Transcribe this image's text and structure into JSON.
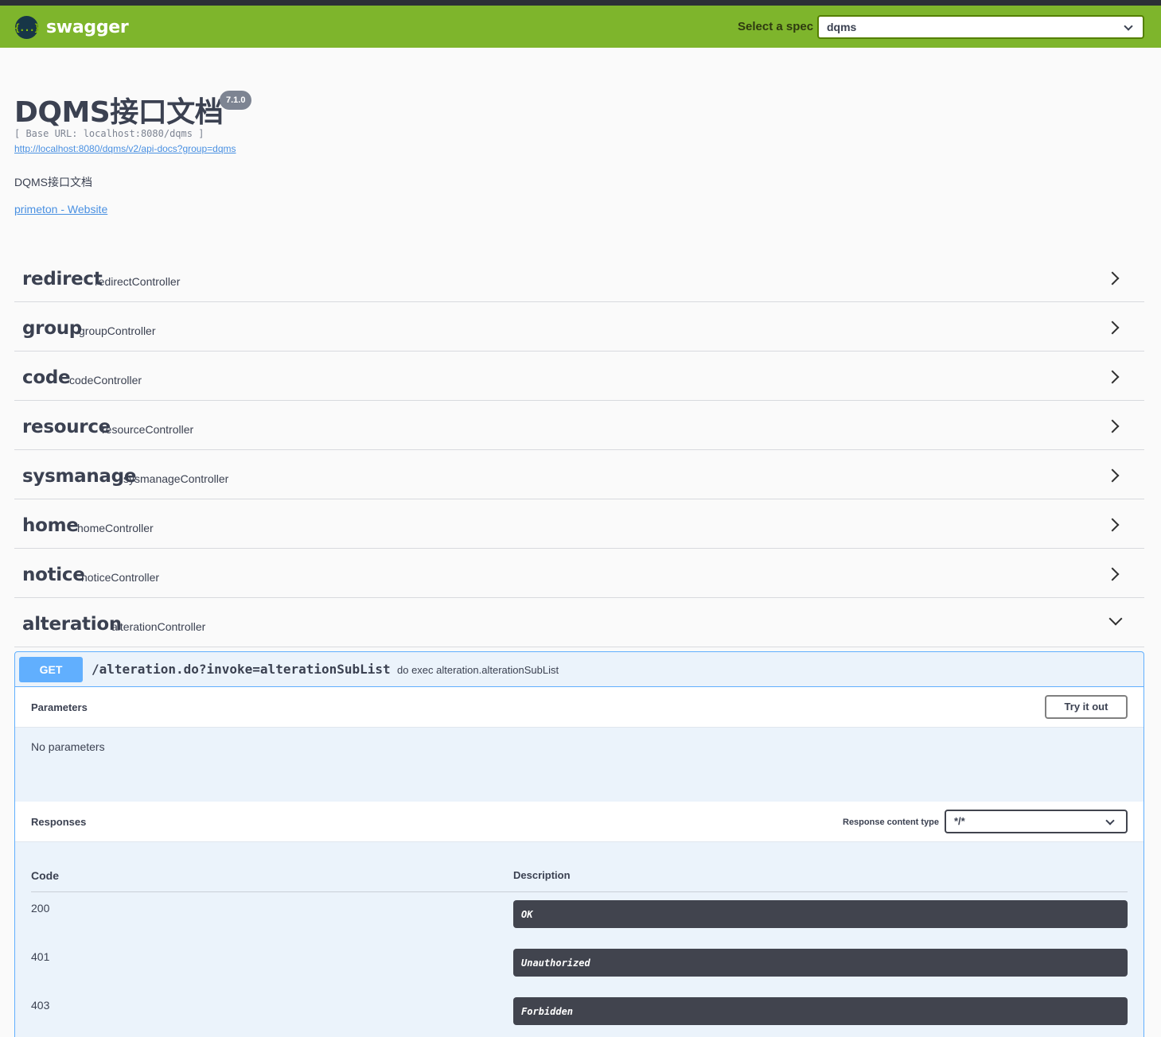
{
  "topbar": {
    "logo_glyph": "{...}",
    "logo_text": "swagger",
    "spec_label": "Select a spec",
    "spec_value": "dqms"
  },
  "info": {
    "title": "DQMS接口文档",
    "version": "7.1.0",
    "base_url": "[ Base URL: localhost:8080/dqms ]",
    "spec_link": "http://localhost:8080/dqms/v2/api-docs?group=dqms",
    "description": "DQMS接口文档",
    "website_link": "primeton - Website"
  },
  "tags": [
    {
      "name": "redirect",
      "desc": "redirectController",
      "expanded": false
    },
    {
      "name": "group",
      "desc": "groupController",
      "expanded": false
    },
    {
      "name": "code",
      "desc": "codeController",
      "expanded": false
    },
    {
      "name": "resource",
      "desc": "resourceController",
      "expanded": false
    },
    {
      "name": "sysmanage",
      "desc": "sysmanageController",
      "expanded": false
    },
    {
      "name": "home",
      "desc": "homeController",
      "expanded": false
    },
    {
      "name": "notice",
      "desc": "noticeController",
      "expanded": false
    },
    {
      "name": "alteration",
      "desc": "alterationController",
      "expanded": true
    }
  ],
  "operation": {
    "method": "GET",
    "path": "/alteration.do?invoke=alterationSubList",
    "summary": "do exec alteration.alterationSubList",
    "parameters_title": "Parameters",
    "try_label": "Try it out",
    "no_params": "No parameters",
    "responses_title": "Responses",
    "content_type_label": "Response content type",
    "content_type_value": "*/*",
    "col_code": "Code",
    "col_desc": "Description",
    "responses": [
      {
        "code": "200",
        "desc": "OK"
      },
      {
        "code": "401",
        "desc": "Unauthorized"
      },
      {
        "code": "403",
        "desc": "Forbidden"
      }
    ]
  },
  "colors": {
    "topbar": "#7eb52c",
    "get": "#61affe",
    "text": "#3b4151",
    "link": "#4990e2"
  }
}
